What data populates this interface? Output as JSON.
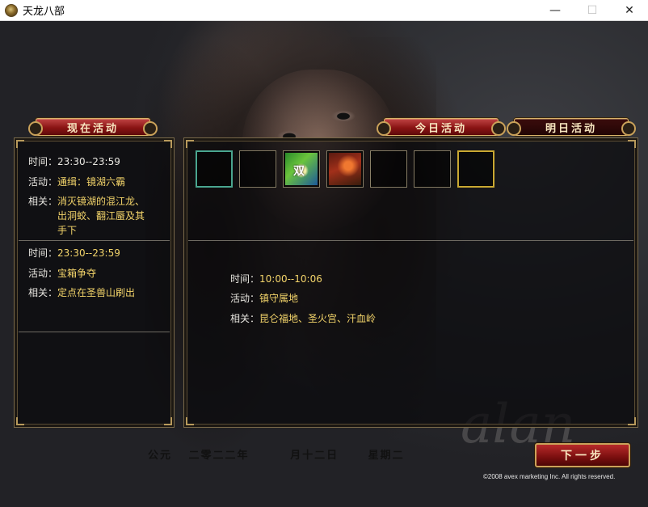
{
  "window": {
    "title": "天龙八部",
    "minimize": "—",
    "maximize": "☐",
    "close": "✕"
  },
  "banners": {
    "current": "现在活动",
    "today": "今日活动",
    "tomorrow": "明日活动"
  },
  "left_panel": {
    "entries": [
      {
        "time_label": "时间：",
        "time_value": "23:30--23:59",
        "activity_label": "活动：",
        "activity_value": "通缉：镜湖六霸",
        "related_label": "相关：",
        "related_lines": [
          "消灭镜湖的混江龙、",
          "出洞蛟、翻江蜃及其",
          "手下"
        ]
      },
      {
        "time_label": "时间：",
        "time_value": "23:30--23:59",
        "activity_label": "活动：",
        "activity_value": "宝箱争夺",
        "related_label": "相关：",
        "related_lines": [
          "定点在圣兽山刷出"
        ]
      }
    ]
  },
  "right_panel": {
    "slot_icons": [
      "empty-slot-selected",
      "empty-slot",
      "quest-icon-green",
      "battle-icon-red",
      "empty-slot",
      "empty-slot",
      "empty-slot-gold"
    ],
    "slot_text": "双",
    "detail": {
      "time_label": "时间：",
      "time_value": "10:00--10:06",
      "activity_label": "活动：",
      "activity_value": "镇守属地",
      "related_label": "相关：",
      "related_value": "昆仑福地、圣火宫、汗血岭"
    }
  },
  "footer": {
    "date_parts": [
      "公元",
      "二零二二年",
      "月十二日",
      "星期二"
    ],
    "next_button": "下一步",
    "copyright": "©2008 avex marketing Inc. All rights reserved.",
    "watermark": "alan"
  },
  "colors": {
    "accent_red": "#8a1414",
    "gold_text": "#f3d46a",
    "frame_gold": "#b89a5c"
  }
}
